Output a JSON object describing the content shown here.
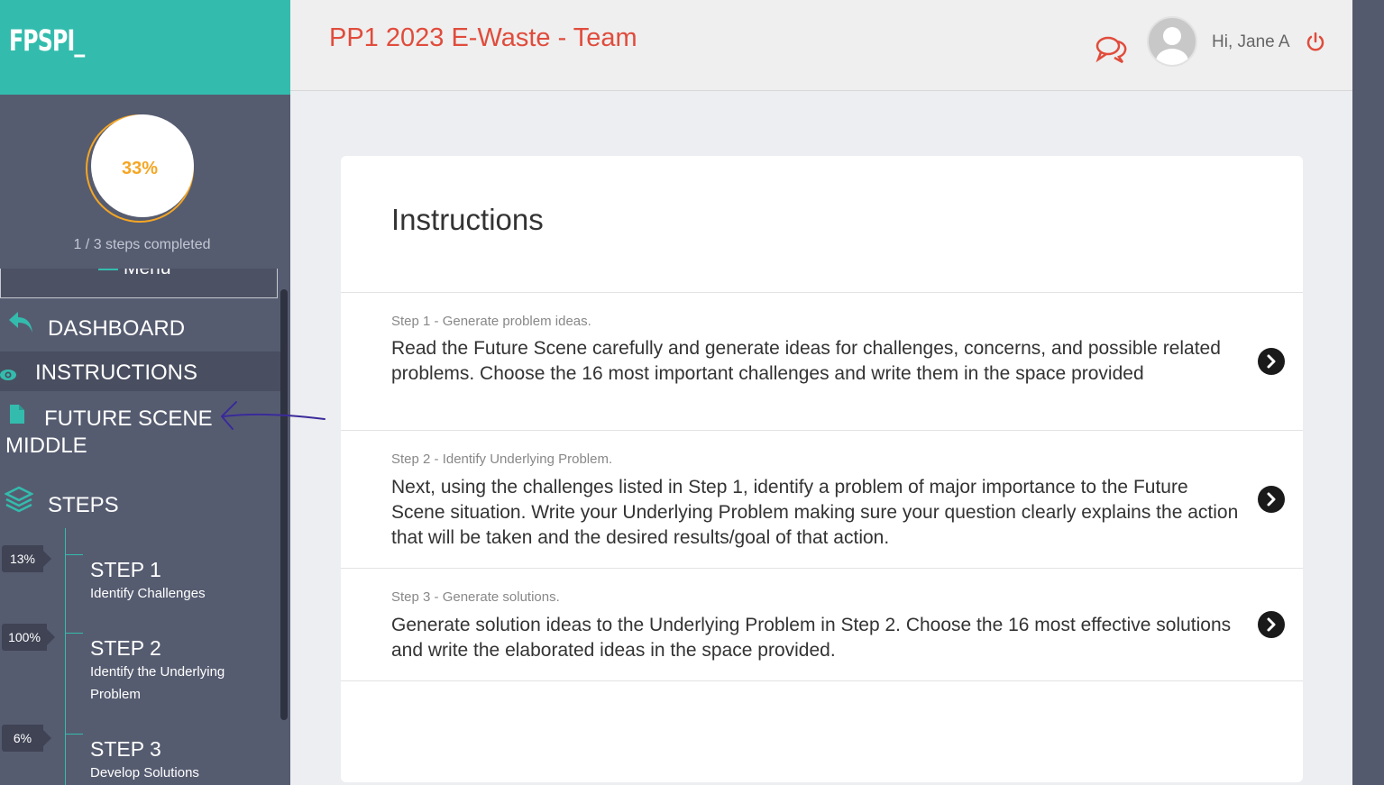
{
  "brand": {
    "name": "FPSPI_"
  },
  "progress": {
    "percent_label": "33%",
    "fraction": 0.33,
    "steps_completed": "1 / 3 steps completed"
  },
  "sidebar": {
    "menu_label": "Menu",
    "nav": {
      "dashboard": "DASHBOARD",
      "instructions": "INSTRUCTIONS",
      "future_scene_line1": "FUTURE SCENE",
      "future_scene_line2": "MIDDLE",
      "steps": "STEPS"
    },
    "steps": [
      {
        "pct": "13%",
        "title": "STEP 1",
        "subtitle": "Identify Challenges"
      },
      {
        "pct": "100%",
        "title": "STEP 2",
        "subtitle": "Identify the Underlying Problem"
      },
      {
        "pct": "6%",
        "title": "STEP 3",
        "subtitle": "Develop Solutions"
      }
    ]
  },
  "header": {
    "title": "PP1 2023 E-Waste - Team",
    "greeting": "Hi, Jane A"
  },
  "card": {
    "title": "Instructions",
    "rows": [
      {
        "label": "Step 1 - Generate problem ideas.",
        "text": "Read the Future Scene carefully and generate ideas for challenges, concerns, and possible related problems. Choose the 16 most important challenges and write them in the space provided"
      },
      {
        "label": "Step 2 - Identify Underlying Problem.",
        "text": "Next, using the challenges listed in Step 1, identify a problem of major importance to the Future Scene situation. Write your Underlying Problem making sure your question clearly explains the action that will be taken and the desired results/goal of that action."
      },
      {
        "label": "Step 3 - Generate solutions.",
        "text": "Generate solution ideas to the Underlying Problem in Step 2. Choose the 16 most effective solutions and write the elaborated ideas in the space provided."
      }
    ]
  },
  "colors": {
    "brand_teal": "#33bcad",
    "sidebar_bg": "#565c70",
    "title_red": "#e04c3c",
    "progress_orange": "#f5a623",
    "annotation_purple": "#3a2a9a"
  }
}
